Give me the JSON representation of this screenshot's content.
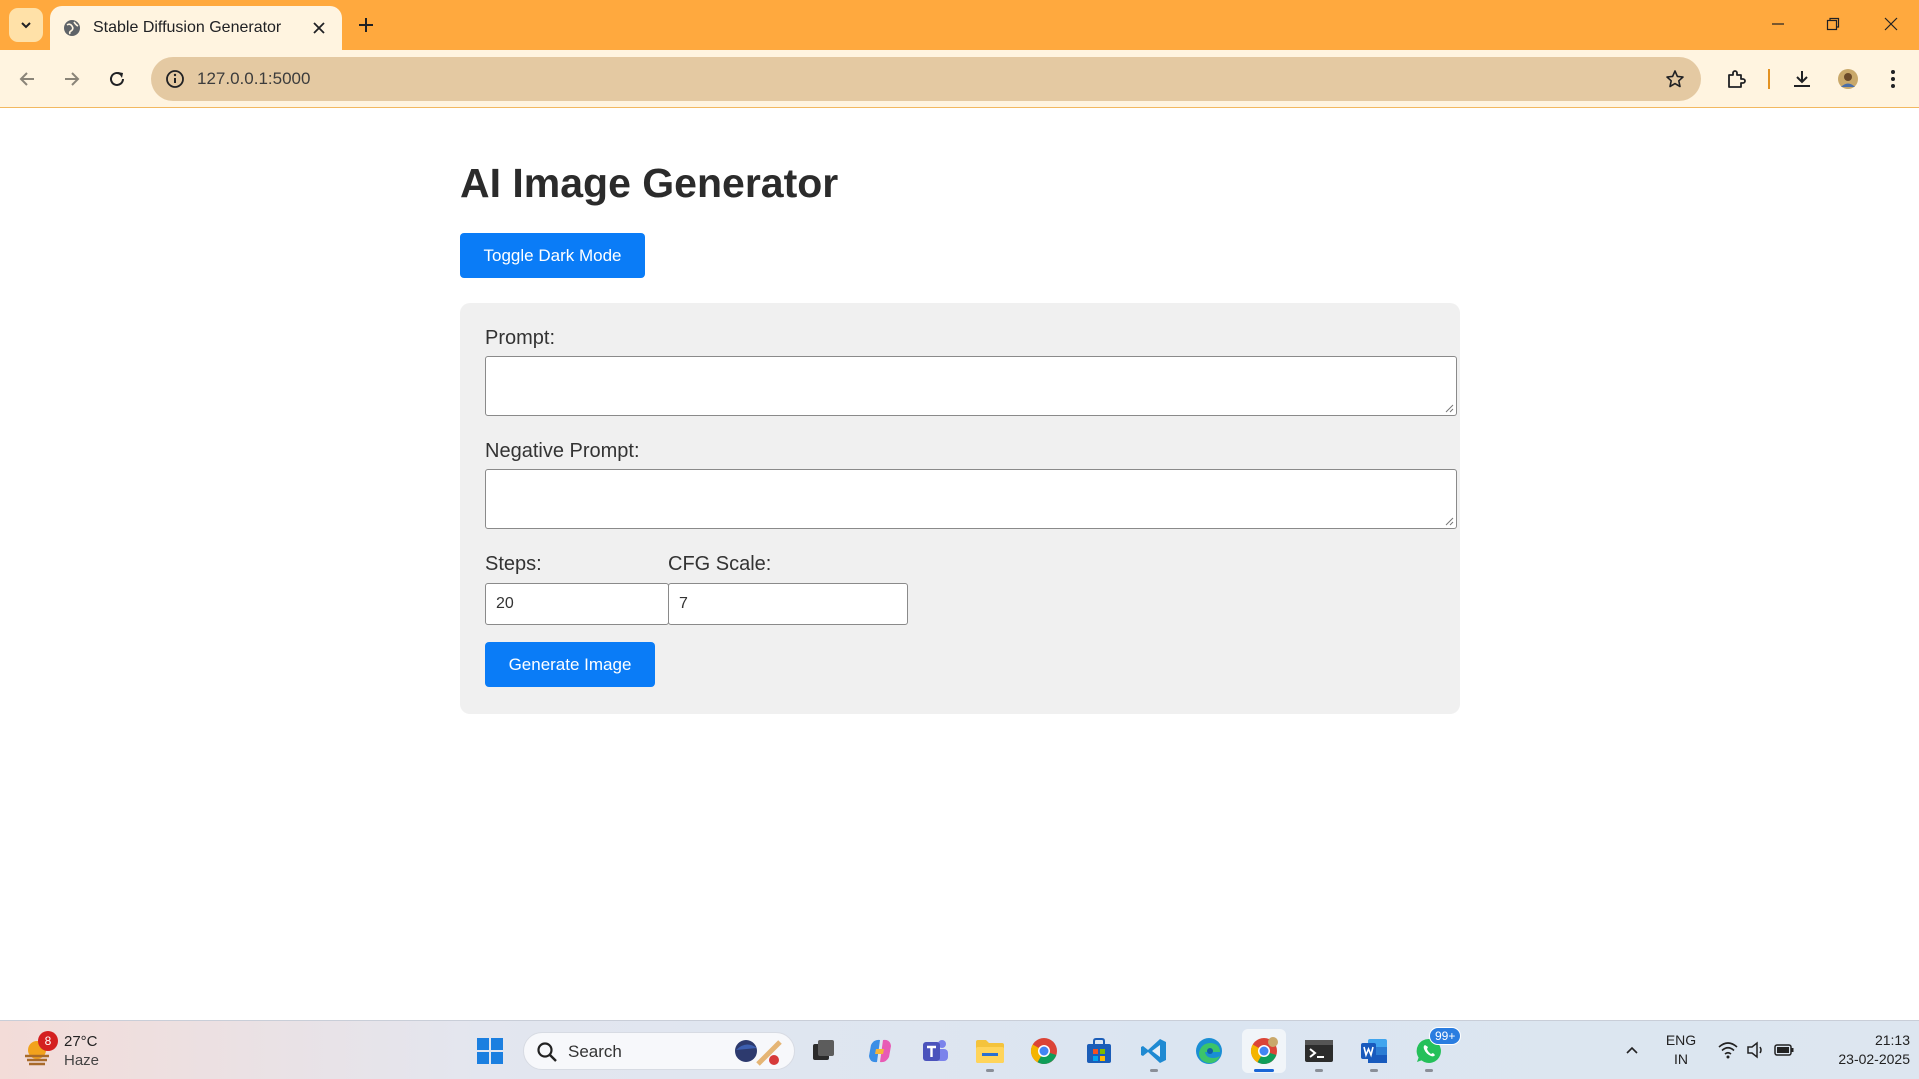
{
  "browser": {
    "tab_title": "Stable Diffusion Generator",
    "url": "127.0.0.1:5000"
  },
  "page": {
    "heading": "AI Image Generator",
    "toggle_label": "Toggle Dark Mode",
    "prompt_label": "Prompt:",
    "prompt_value": "",
    "negative_label": "Negative Prompt:",
    "negative_value": "",
    "steps_label": "Steps:",
    "steps_value": "20",
    "cfg_label": "CFG Scale:",
    "cfg_value": "7",
    "generate_label": "Generate Image"
  },
  "taskbar": {
    "weather_badge": "8",
    "temperature": "27°C",
    "condition": "Haze",
    "search_placeholder": "Search",
    "whatsapp_badge": "99+",
    "lang_line1": "ENG",
    "lang_line2": "IN",
    "time": "21:13",
    "date": "23-02-2025",
    "apps": [
      "start",
      "search",
      "task-view",
      "copilot",
      "teams",
      "file-explorer",
      "chrome",
      "microsoft-store",
      "vscode",
      "edge",
      "chrome-profile",
      "terminal",
      "word",
      "whatsapp"
    ]
  },
  "colors": {
    "tab_strip": "#ffa93e",
    "toolbar": "#fff4e0",
    "primary_button": "#0a7cf7",
    "card_bg": "#f0f0f0"
  }
}
